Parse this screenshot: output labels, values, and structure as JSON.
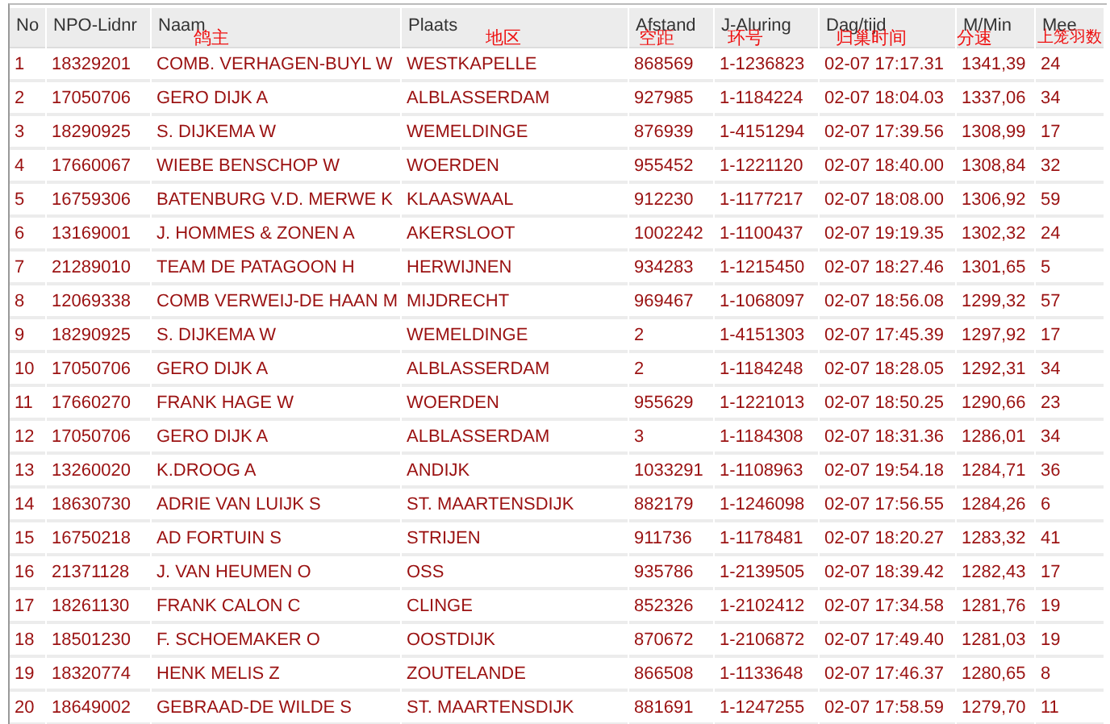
{
  "table": {
    "columns": [
      {
        "label": "No"
      },
      {
        "label": "NPO-Lidnr"
      },
      {
        "label": "Naam",
        "note": "鸽主"
      },
      {
        "label": "Plaats",
        "note": "地区"
      },
      {
        "label": "Afstand",
        "note": "空距"
      },
      {
        "label": "J-Aluring",
        "note": "环号"
      },
      {
        "label": "Dag/tijd",
        "note": "归巢时间"
      },
      {
        "label": "M/Min",
        "note": "分速"
      },
      {
        "label": "Mee",
        "note": "上笼羽数"
      }
    ],
    "rows": [
      [
        "1",
        "18329201",
        "COMB. VERHAGEN-BUYL W",
        "WESTKAPELLE",
        "868569",
        "1-1236823",
        "02-07 17:17.31",
        "1341,39",
        "24"
      ],
      [
        "2",
        "17050706",
        "GERO DIJK A",
        "ALBLASSERDAM",
        "927985",
        "1-1184224",
        "02-07 18:04.03",
        "1337,06",
        "34"
      ],
      [
        "3",
        "18290925",
        "S. DIJKEMA W",
        "WEMELDINGE",
        "876939",
        "1-4151294",
        "02-07 17:39.56",
        "1308,99",
        "17"
      ],
      [
        "4",
        "17660067",
        "WIEBE BENSCHOP W",
        "WOERDEN",
        "955452",
        "1-1221120",
        "02-07 18:40.00",
        "1308,84",
        "32"
      ],
      [
        "5",
        "16759306",
        "BATENBURG V.D. MERWE K",
        "KLAASWAAL",
        "912230",
        "1-1177217",
        "02-07 18:08.00",
        "1306,92",
        "59"
      ],
      [
        "6",
        "13169001",
        "J. HOMMES & ZONEN A",
        "AKERSLOOT",
        "1002242",
        "1-1100437",
        "02-07 19:19.35",
        "1302,32",
        "24"
      ],
      [
        "7",
        "21289010",
        "TEAM DE PATAGOON H",
        "HERWIJNEN",
        "934283",
        "1-1215450",
        "02-07 18:27.46",
        "1301,65",
        "5"
      ],
      [
        "8",
        "12069338",
        "COMB VERWEIJ-DE HAAN M",
        "MIJDRECHT",
        "969467",
        "1-1068097",
        "02-07 18:56.08",
        "1299,32",
        "57"
      ],
      [
        "9",
        "18290925",
        "S. DIJKEMA W",
        "WEMELDINGE",
        "2",
        "1-4151303",
        "02-07 17:45.39",
        "1297,92",
        "17"
      ],
      [
        "10",
        "17050706",
        "GERO DIJK A",
        "ALBLASSERDAM",
        "2",
        "1-1184248",
        "02-07 18:28.05",
        "1292,31",
        "34"
      ],
      [
        "11",
        "17660270",
        "FRANK HAGE W",
        "WOERDEN",
        "955629",
        "1-1221013",
        "02-07 18:50.25",
        "1290,66",
        "23"
      ],
      [
        "12",
        "17050706",
        "GERO DIJK A",
        "ALBLASSERDAM",
        "3",
        "1-1184308",
        "02-07 18:31.36",
        "1286,01",
        "34"
      ],
      [
        "13",
        "13260020",
        "K.DROOG A",
        "ANDIJK",
        "1033291",
        "1-1108963",
        "02-07 19:54.18",
        "1284,71",
        "36"
      ],
      [
        "14",
        "18630730",
        "ADRIE VAN LUIJK S",
        "ST. MAARTENSDIJK",
        "882179",
        "1-1246098",
        "02-07 17:56.55",
        "1284,26",
        "6"
      ],
      [
        "15",
        "16750218",
        "AD FORTUIN S",
        "STRIJEN",
        "911736",
        "1-1178481",
        "02-07 18:20.27",
        "1283,32",
        "41"
      ],
      [
        "16",
        "21371128",
        "J. VAN HEUMEN O",
        "OSS",
        "935786",
        "1-2139505",
        "02-07 18:39.42",
        "1282,43",
        "17"
      ],
      [
        "17",
        "18261130",
        "FRANK CALON C",
        "CLINGE",
        "852326",
        "1-2102412",
        "02-07 17:34.58",
        "1281,76",
        "19"
      ],
      [
        "18",
        "18501230",
        "F. SCHOEMAKER O",
        "OOSTDIJK",
        "870672",
        "1-2106872",
        "02-07 17:49.40",
        "1281,03",
        "19"
      ],
      [
        "19",
        "18320774",
        "HENK MELIS Z",
        "ZOUTELANDE",
        "866508",
        "1-1133648",
        "02-07 17:46.37",
        "1280,65",
        "8"
      ],
      [
        "20",
        "18649002",
        "GEBRAAD-DE WILDE S",
        "ST. MAARTENSDIJK",
        "881691",
        "1-1247255",
        "02-07 17:58.59",
        "1279,70",
        "11"
      ]
    ]
  }
}
